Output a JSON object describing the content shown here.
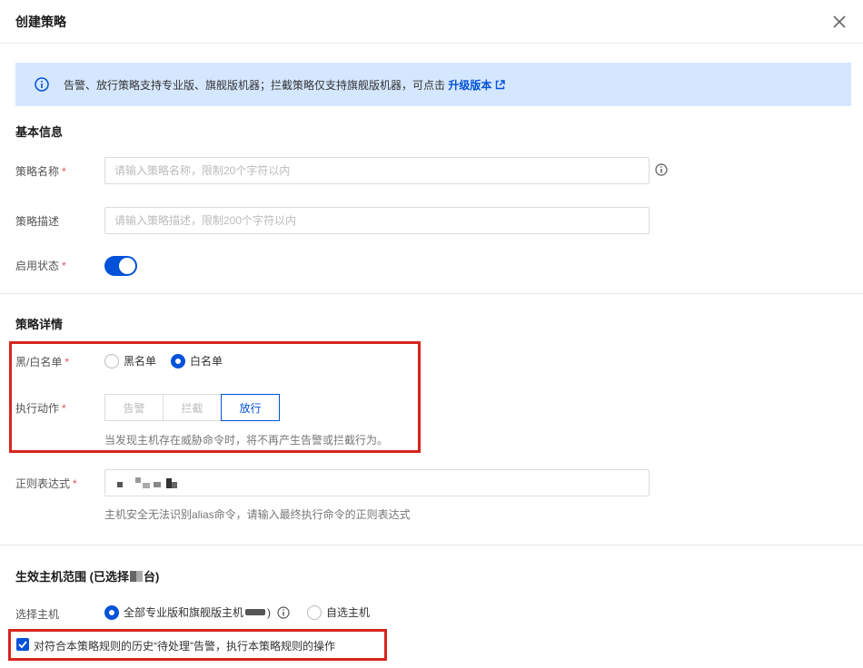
{
  "dialog": {
    "title": "创建策略"
  },
  "notice": {
    "text": "告警、放行策略支持专业版、旗舰版机器；拦截策略仅支持旗舰版机器，可点击",
    "link": "升级版本"
  },
  "basic": {
    "title": "基本信息",
    "name_label": "策略名称",
    "name_placeholder": "请输入策略名称，限制20个字符以内",
    "desc_label": "策略描述",
    "desc_placeholder": "请输入策略描述，限制200个字符以内",
    "status_label": "启用状态",
    "status_on": true
  },
  "detail": {
    "title": "策略详情",
    "list_label": "黑/白名单",
    "list_options": [
      "黑名单",
      "白名单"
    ],
    "list_selected": "白名单",
    "action_label": "执行动作",
    "actions": [
      "告警",
      "拦截",
      "放行"
    ],
    "action_selected": "放行",
    "action_hint": "当发现主机存在威胁命令时，将不再产生告警或拦截行为。",
    "regex_label": "正则表达式",
    "regex_hint": "主机安全无法识别alias命令，请输入最终执行命令的正则表达式"
  },
  "scope": {
    "title_prefix": "生效主机范围 (已选择",
    "title_suffix": "台)",
    "host_label": "选择主机",
    "options": [
      "全部专业版和旗舰版主机",
      "自选主机"
    ],
    "selected": "全部专业版和旗舰版主机",
    "paren_close": ")",
    "apply_history_label": "对符合本策略规则的历史“待处理”告警，执行本策略规则的操作",
    "apply_history_checked": true
  },
  "colors": {
    "primary": "#0052d9",
    "highlight": "#d6251d",
    "notice_bg": "#d5e7ff"
  }
}
